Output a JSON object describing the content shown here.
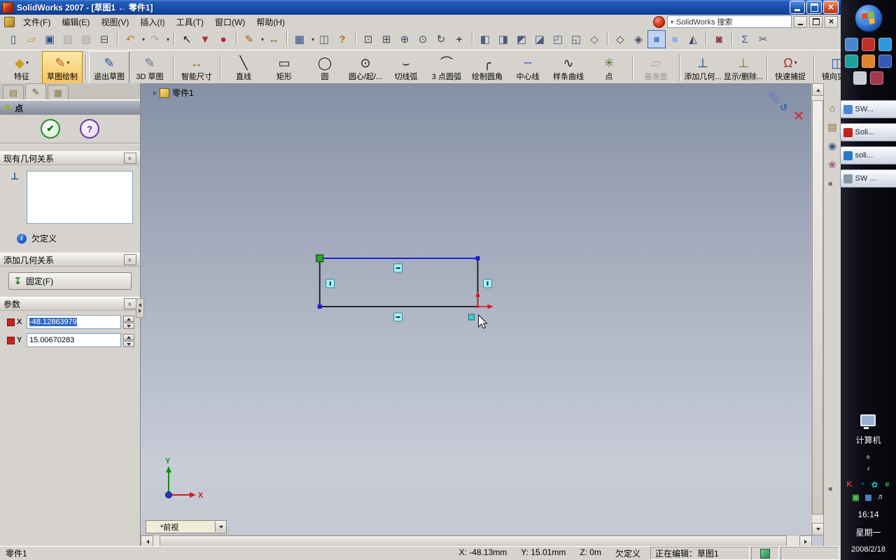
{
  "titlebar": {
    "title": "SolidWorks 2007 - [草图1 ← 零件1]"
  },
  "menubar": {
    "items": [
      {
        "name": "menu-file",
        "label": "文件(F)"
      },
      {
        "name": "menu-edit",
        "label": "编辑(E)"
      },
      {
        "name": "menu-view",
        "label": "视图(V)"
      },
      {
        "name": "menu-insert",
        "label": "插入(I)"
      },
      {
        "name": "menu-tools",
        "label": "工具(T)"
      },
      {
        "name": "menu-window",
        "label": "窗口(W)"
      },
      {
        "name": "menu-help",
        "label": "帮助(H)"
      }
    ],
    "search_label": "SolidWorks 搜索"
  },
  "icons": {
    "close_glyph": "✕",
    "dropdown_glyph": "▾",
    "collapse_glyph": "«",
    "pencil_glyph": "✎",
    "update_arrow_glyph": "↺",
    "point_glyph": "✳",
    "check_glyph": "✔",
    "help_glyph": "?",
    "info_glyph": "i",
    "relation_glyph": "⊥",
    "fix_glyph": "↧"
  },
  "toolbar_main": {
    "items": [
      {
        "name": "new-document-button",
        "glyph": "▯",
        "style": "color:#2a4f90"
      },
      {
        "name": "open-folder-button",
        "glyph": "▱",
        "style": "color:#c89020"
      },
      {
        "name": "save-button",
        "glyph": "▣",
        "style": "color:#2a4f90"
      },
      {
        "name": "make-drawing-button",
        "glyph": "▤",
        "style": "color:#a8a49c",
        "disabled": true
      },
      {
        "name": "make-assembly-button",
        "glyph": "▥",
        "style": "color:#a8a49c",
        "disabled": true
      },
      {
        "name": "print-button",
        "glyph": "⊟",
        "style": "color:#4a5a70"
      },
      {
        "name": "undo-button",
        "glyph": "↶",
        "style": "color:#d07818",
        "dd": true,
        "sep": true
      },
      {
        "name": "redo-button",
        "glyph": "↷",
        "style": "color:#a8a49c",
        "dd": true,
        "disabled": true
      },
      {
        "name": "select-button",
        "glyph": "↖",
        "style": "color:#1a1a1a",
        "sep": true
      },
      {
        "name": "selection-filter-button",
        "glyph": "▼",
        "style": "color:#b03030"
      },
      {
        "name": "record-macro-button",
        "glyph": "●",
        "style": "color:#c02020"
      },
      {
        "name": "sketch-button",
        "glyph": "✎",
        "style": "color:#b05a10",
        "dd": true,
        "sep": true
      },
      {
        "name": "smart-dimension-button",
        "glyph": "↔",
        "style": "color:#806020"
      },
      {
        "name": "view-settings-button",
        "glyph": "▦",
        "style": "color:#2a4f90",
        "dd": true,
        "sep": true
      },
      {
        "name": "hide-show-items-button",
        "glyph": "◫",
        "style": "color:#4a5a70"
      },
      {
        "name": "help-button",
        "glyph": "?",
        "style": "color:#b07010;font-weight:bold"
      },
      {
        "name": "zoom-fit-button",
        "glyph": "⊡",
        "style": "color:#3a4a60",
        "sep": true
      },
      {
        "name": "zoom-area-button",
        "glyph": "⊞",
        "style": "color:#3a4a60"
      },
      {
        "name": "zoom-in-out-button",
        "glyph": "⊕",
        "style": "color:#3a4a60"
      },
      {
        "name": "zoom-selection-button",
        "glyph": "⊙",
        "style": "color:#3a4a60"
      },
      {
        "name": "rotate-view-button",
        "glyph": "↻",
        "style": "color:#3a4a60"
      },
      {
        "name": "pan-button",
        "glyph": "+",
        "style": "color:#3a4a60;font-weight:bold"
      },
      {
        "name": "view-front-button",
        "glyph": "◧",
        "style": "color:#4a5a80",
        "sep": true
      },
      {
        "name": "view-back-button",
        "glyph": "◨",
        "style": "color:#4a5a80"
      },
      {
        "name": "view-left-button",
        "glyph": "◩",
        "style": "color:#4a5a80"
      },
      {
        "name": "view-right-button",
        "glyph": "◪",
        "style": "color:#4a5a80"
      },
      {
        "name": "view-top-button",
        "glyph": "◰",
        "style": "color:#4a5a80"
      },
      {
        "name": "view-bottom-button",
        "glyph": "◱",
        "style": "color:#4a5a80"
      },
      {
        "name": "view-isometric-button",
        "glyph": "◇",
        "style": "color:#4a5a80"
      },
      {
        "name": "wireframe-button",
        "glyph": "◇",
        "style": "color:#3a4a60",
        "sep": true
      },
      {
        "name": "hidden-lines-button",
        "glyph": "◈",
        "style": "color:#3a4a60"
      },
      {
        "name": "shaded-edges-button",
        "glyph": "■",
        "style": "color:#5b82c8",
        "active": true
      },
      {
        "name": "shaded-button",
        "glyph": "■",
        "style": "color:#8fb0e0"
      },
      {
        "name": "section-view-button",
        "glyph": "◭",
        "style": "color:#3a4a60"
      },
      {
        "name": "realview-button",
        "glyph": "◙",
        "style": "color:#803030",
        "sep": true
      },
      {
        "name": "equations-button",
        "glyph": "Σ",
        "style": "color:#3a5a8a",
        "sep": true
      },
      {
        "name": "trim-entities-button",
        "glyph": "✂",
        "style": "color:#4a5a70"
      }
    ]
  },
  "toolbar_sketch": {
    "items": [
      {
        "name": "features-tab-button",
        "label": "特征",
        "glyph": "◆",
        "style": "color:#c8a020",
        "dd": true
      },
      {
        "name": "sketch-draw-button",
        "label": "草图绘制",
        "glyph": "✎",
        "style": "color:#b05a10",
        "dd": true,
        "active": true
      },
      {
        "name": "exit-sketch-button",
        "label": "退出草图",
        "glyph": "✎",
        "style": "color:#2050b0",
        "raised": true,
        "sep": true
      },
      {
        "name": "3d-sketch-button",
        "label": "3D 草图",
        "glyph": "✎",
        "style": "color:#607890"
      },
      {
        "name": "smart-dimension-tool-button",
        "label": "智能尺寸",
        "glyph": "↔",
        "style": "color:#9a7010",
        "sep": true
      },
      {
        "name": "line-tool-button",
        "label": "直线",
        "glyph": "╲",
        "style": "color:#202020",
        "sep": true
      },
      {
        "name": "rectangle-tool-button",
        "label": "矩形",
        "glyph": "▭",
        "style": "color:#202020"
      },
      {
        "name": "circle-tool-button",
        "label": "圆",
        "glyph": "◯",
        "style": "color:#202020"
      },
      {
        "name": "centerpoint-arc-tool-button",
        "label": "圆心/起/...",
        "glyph": "⊙",
        "style": "color:#202020"
      },
      {
        "name": "tangent-arc-tool-button",
        "label": "切线弧",
        "glyph": "⌣",
        "style": "color:#202020"
      },
      {
        "name": "three-point-arc-tool-button",
        "label": "3 点圆弧",
        "glyph": "⌒",
        "style": "color:#202020"
      },
      {
        "name": "fillet-tool-button",
        "label": "绘制圆角",
        "glyph": "╭",
        "style": "color:#202020"
      },
      {
        "name": "centerline-tool-button",
        "label": "中心线",
        "glyph": "┄",
        "style": "color:#2050b0"
      },
      {
        "name": "spline-tool-button",
        "label": "样条曲线",
        "glyph": "∿",
        "style": "color:#202020"
      },
      {
        "name": "point-tool-button",
        "label": "点",
        "glyph": "✳",
        "style": "color:#507820"
      },
      {
        "name": "plane-tool-button",
        "label": "基准面",
        "glyph": "▱",
        "style": "color:#a8a49c",
        "disabled": true,
        "sep": true
      },
      {
        "name": "add-relation-button",
        "label": "添加几何...",
        "glyph": "⊥",
        "style": "color:#104080",
        "sep": true
      },
      {
        "name": "display-relations-button",
        "label": "显示/删除...",
        "glyph": "⊥",
        "style": "color:#9a6a20"
      },
      {
        "name": "quick-snaps-button",
        "label": "快速捕捉",
        "glyph": "Ω",
        "style": "color:#b03030",
        "dd": true,
        "sep": true
      },
      {
        "name": "mirror-entities-button",
        "label": "镜向实体",
        "glyph": "◫",
        "style": "color:#2050b0",
        "sep": true
      }
    ]
  },
  "property_panel": {
    "tabs": [
      {
        "name": "featuremanager-tab",
        "glyph": "▤",
        "style": "color:#8a7a40"
      },
      {
        "name": "propertymanager-tab",
        "glyph": "✎",
        "style": "color:#6a5a20",
        "active": true
      },
      {
        "name": "configurationmanager-tab",
        "glyph": "▦",
        "style": "color:#8a7a40"
      }
    ],
    "title": "点",
    "groups": {
      "existing_relations": {
        "title": "现有几何关系"
      },
      "status": "欠定义",
      "add_relations": {
        "title": "添加几何关系",
        "fix_label": "固定(F)"
      },
      "parameters": {
        "title": "参数",
        "x_label": "X",
        "x_value": "-48.12863979",
        "y_label": "Y",
        "y_value": "15.00670283"
      }
    }
  },
  "viewport": {
    "document_label": "零件1",
    "orientation_selector": "*前视",
    "triad": {
      "x_label": "X",
      "y_label": "Y"
    },
    "sketch": {
      "selected_point": {
        "x": "-48.12863979",
        "y": "15.00670283"
      },
      "constraints": [
        "horizontal-top",
        "horizontal-bottom",
        "vertical-left",
        "vertical-right"
      ],
      "status": "欠定义"
    }
  },
  "task_pane": {
    "icons": [
      {
        "name": "resources-home-icon",
        "glyph": "⌂",
        "style": "color:#7a5a28"
      },
      {
        "name": "design-library-icon",
        "glyph": "▤",
        "style": "color:#8a6a30"
      },
      {
        "name": "file-explorer-icon",
        "glyph": "◉",
        "style": "color:#3a5a8a"
      },
      {
        "name": "appearances-icon",
        "glyph": "❀",
        "style": "color:#a05080"
      }
    ]
  },
  "statusbar": {
    "left": "零件1",
    "x": "X: -48.13mm",
    "y": "Y: 15.01mm",
    "z": "Z: 0m",
    "state": "欠定义",
    "editing": "正在编辑：草图1"
  },
  "taskbar": {
    "quick_launch": [
      {
        "style": "background:#4a86d0"
      },
      {
        "style": "background:#c03028"
      },
      {
        "style": "background:#2a9ad8"
      },
      {
        "style": "background:#1fa0a0"
      },
      {
        "style": "background:#e08428"
      },
      {
        "style": "background:#3858b8"
      },
      {
        "style": "background:#c8ccd8"
      },
      {
        "style": "background:#a03850"
      }
    ],
    "windows": [
      {
        "label": "SW...",
        "style": "background:#4a86d8"
      },
      {
        "label": "Soli...",
        "style": "background:#c02020"
      },
      {
        "label": "soli...",
        "style": "background:#2878c8"
      },
      {
        "label": "SW ...",
        "style": "background:#8898a8"
      }
    ],
    "computer_label": "计算机",
    "chevron_up": "«",
    "chevron_left": "‹",
    "tray": [
      {
        "glyph": "K",
        "style": "color:#e04030"
      },
      {
        "glyph": "◔",
        "style": "color:#3078c8"
      },
      {
        "glyph": "✿",
        "style": "color:#20b0b0"
      },
      {
        "glyph": "e",
        "style": "color:#40a040"
      },
      {
        "glyph": "▣",
        "style": "color:#50c050"
      },
      {
        "glyph": "▦",
        "style": "color:#5090d0"
      },
      {
        "glyph": "♬",
        "style": "color:#e0e0e8"
      }
    ],
    "clock": {
      "time": "16:14",
      "day": "星期一",
      "date": "2008/2/18"
    }
  }
}
